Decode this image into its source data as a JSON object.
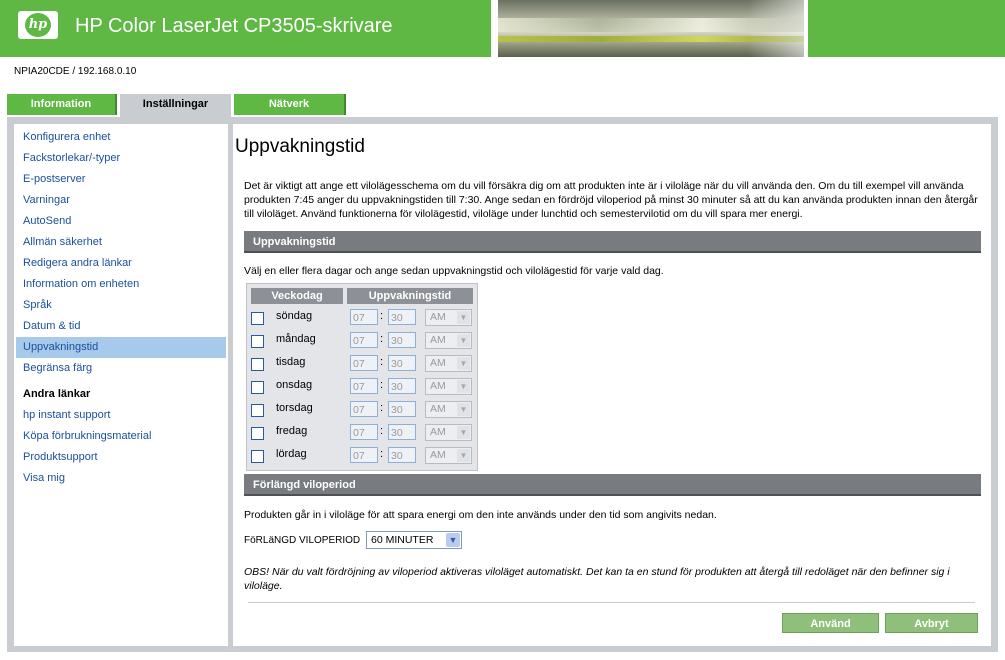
{
  "header": {
    "logo_text": "hp",
    "title": "HP Color LaserJet CP3505-skrivare"
  },
  "device": "NPIA20CDE / 192.168.0.10",
  "tabs": [
    {
      "label": "Information"
    },
    {
      "label": "Inställningar"
    },
    {
      "label": "Nätverk"
    }
  ],
  "sidebar": {
    "items": [
      {
        "label": "Konfigurera enhet"
      },
      {
        "label": "Fackstorlekar/-typer"
      },
      {
        "label": "E-postserver"
      },
      {
        "label": "Varningar"
      },
      {
        "label": "AutoSend"
      },
      {
        "label": "Allmän säkerhet"
      },
      {
        "label": "Redigera andra länkar"
      },
      {
        "label": "Information om enheten"
      },
      {
        "label": "Språk"
      },
      {
        "label": "Datum & tid"
      },
      {
        "label": "Uppvakningstid"
      },
      {
        "label": "Begränsa färg"
      }
    ],
    "other_heading": "Andra länkar",
    "other_links": [
      {
        "label": "hp instant support"
      },
      {
        "label": "Köpa förbrukningsmaterial"
      },
      {
        "label": "Produktsupport"
      },
      {
        "label": "Visa mig"
      }
    ]
  },
  "main": {
    "title": "Uppvakningstid",
    "intro": "Det är viktigt att ange ett vilolägesschema om du vill försäkra dig om att produkten inte är i viloläge när du vill använda den. Om du till exempel vill använda produkten 7:45 anger du uppvakningstiden till 7:30. Ange sedan en fördröjd viloperiod på minst 30 minuter så att du kan använda produkten innan den återgår till viloläget. Använd funktionerna för vilolägestid, viloläge under lunchtid och semestervilotid om du vill spara mer energi.",
    "section1": "Uppvakningstid",
    "instructions": "Välj en eller flera dagar och ange sedan uppvakningstid och vilolägestid för varje vald dag.",
    "col_day": "Veckodag",
    "col_time": "Uppvakningstid",
    "days": [
      {
        "name": "söndag",
        "hour": "07",
        "minute": "30",
        "ampm": "AM"
      },
      {
        "name": "måndag",
        "hour": "07",
        "minute": "30",
        "ampm": "AM"
      },
      {
        "name": "tisdag",
        "hour": "07",
        "minute": "30",
        "ampm": "AM"
      },
      {
        "name": "onsdag",
        "hour": "07",
        "minute": "30",
        "ampm": "AM"
      },
      {
        "name": "torsdag",
        "hour": "07",
        "minute": "30",
        "ampm": "AM"
      },
      {
        "name": "fredag",
        "hour": "07",
        "minute": "30",
        "ampm": "AM"
      },
      {
        "name": "lördag",
        "hour": "07",
        "minute": "30",
        "ampm": "AM"
      }
    ],
    "section2": "Förlängd viloperiod",
    "desc2": "Produkten går in i viloläge för att spara energi om den inte används under den tid som angivits nedan.",
    "delay_label": "FöRLäNGD VILOPERIOD",
    "delay_value": "60 MINUTER",
    "note": "OBS! När du valt fördröjning av viloperiod aktiveras viloläget automatiskt. Det kan ta en stund för produkten att återgå till redoläget när den befinner sig i viloläge.",
    "apply_label": "Använd",
    "cancel_label": "Avbryt"
  }
}
